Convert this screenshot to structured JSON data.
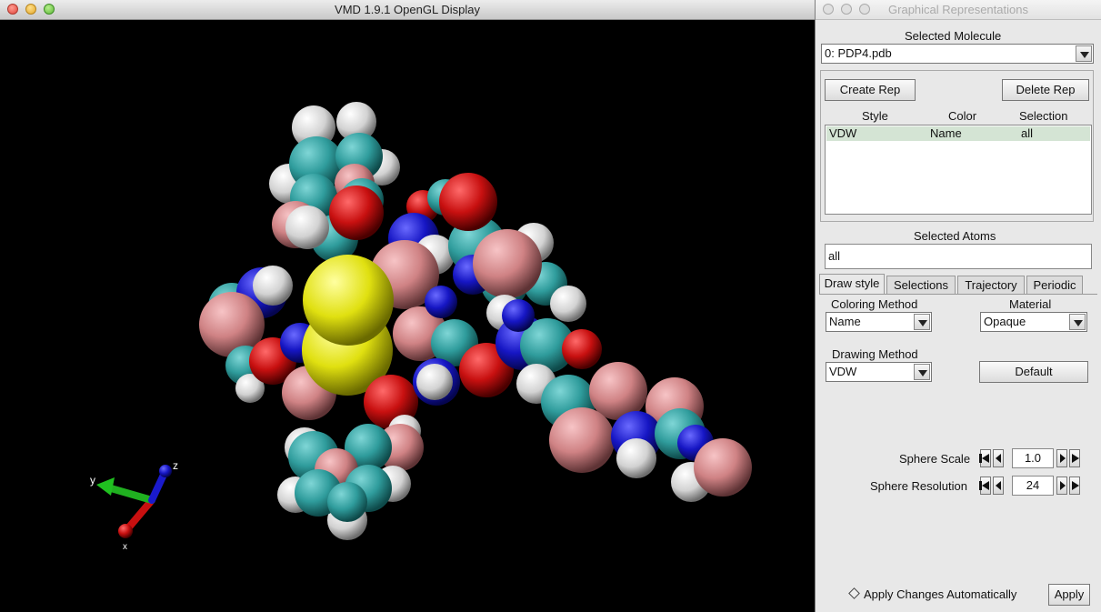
{
  "gl_window": {
    "title": "VMD 1.9.1 OpenGL Display",
    "axes": {
      "x_label": "x",
      "y_label": "y",
      "z_label": "z"
    },
    "atom_colors": {
      "carbon": "#3aa6a6",
      "hydrogen": "#e6e6e6",
      "oxygen": "#d41a1a",
      "nitrogen": "#1a1acc",
      "sulfur": "#e3e31a",
      "other": "#d9898c"
    }
  },
  "rep_window": {
    "title": "Graphical Representations",
    "selected_molecule_label": "Selected Molecule",
    "selected_molecule_value": "0: PDP4.pdb",
    "create_rep_label": "Create Rep",
    "delete_rep_label": "Delete Rep",
    "columns": {
      "style": "Style",
      "color": "Color",
      "selection": "Selection"
    },
    "reps": [
      {
        "style": "VDW",
        "color": "Name",
        "selection": "all"
      }
    ],
    "selected_atoms_label": "Selected Atoms",
    "selected_atoms_value": "all",
    "tabs": [
      "Draw style",
      "Selections",
      "Trajectory",
      "Periodic"
    ],
    "coloring_method_label": "Coloring Method",
    "coloring_method_value": "Name",
    "material_label": "Material",
    "material_value": "Opaque",
    "drawing_method_label": "Drawing Method",
    "drawing_method_value": "VDW",
    "default_label": "Default",
    "sphere_scale_label": "Sphere Scale",
    "sphere_scale_value": "1.0",
    "sphere_resolution_label": "Sphere Resolution",
    "sphere_resolution_value": "24",
    "apply_auto_label": "Apply Changes Automatically",
    "apply_label": "Apply"
  }
}
